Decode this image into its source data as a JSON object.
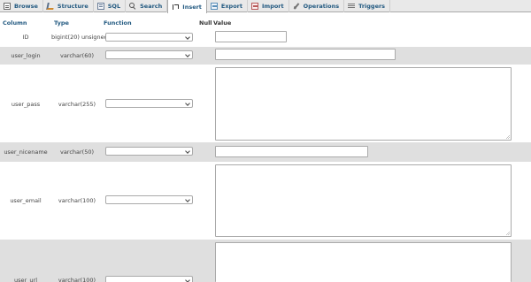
{
  "tabs": [
    {
      "label": "Browse",
      "icon": "browse-icon"
    },
    {
      "label": "Structure",
      "icon": "structure-icon"
    },
    {
      "label": "SQL",
      "icon": "sql-icon"
    },
    {
      "label": "Search",
      "icon": "search-icon"
    },
    {
      "label": "Insert",
      "icon": "insert-icon",
      "active": true
    },
    {
      "label": "Export",
      "icon": "export-icon"
    },
    {
      "label": "Import",
      "icon": "import-icon"
    },
    {
      "label": "Operations",
      "icon": "operations-icon"
    },
    {
      "label": "Triggers",
      "icon": "triggers-icon"
    }
  ],
  "table_header": {
    "column": "Column",
    "type": "Type",
    "function": "Function",
    "null": "Null",
    "value": "Value"
  },
  "rows": [
    {
      "column": "ID",
      "type": "bigint(20) unsigned",
      "function": "",
      "value": ""
    },
    {
      "column": "user_login",
      "type": "varchar(60)",
      "function": "",
      "value": ""
    },
    {
      "column": "user_pass",
      "type": "varchar(255)",
      "function": "",
      "value": ""
    },
    {
      "column": "user_nicename",
      "type": "varchar(50)",
      "function": "",
      "value": ""
    },
    {
      "column": "user_email",
      "type": "varchar(100)",
      "function": "",
      "value": ""
    },
    {
      "column": "user_url",
      "type": "varchar(100)",
      "function": "",
      "value": ""
    }
  ],
  "colors": {
    "link": "#235a81",
    "row_alt": "#dfdfdf",
    "tabbar": "#e9e9e9"
  }
}
